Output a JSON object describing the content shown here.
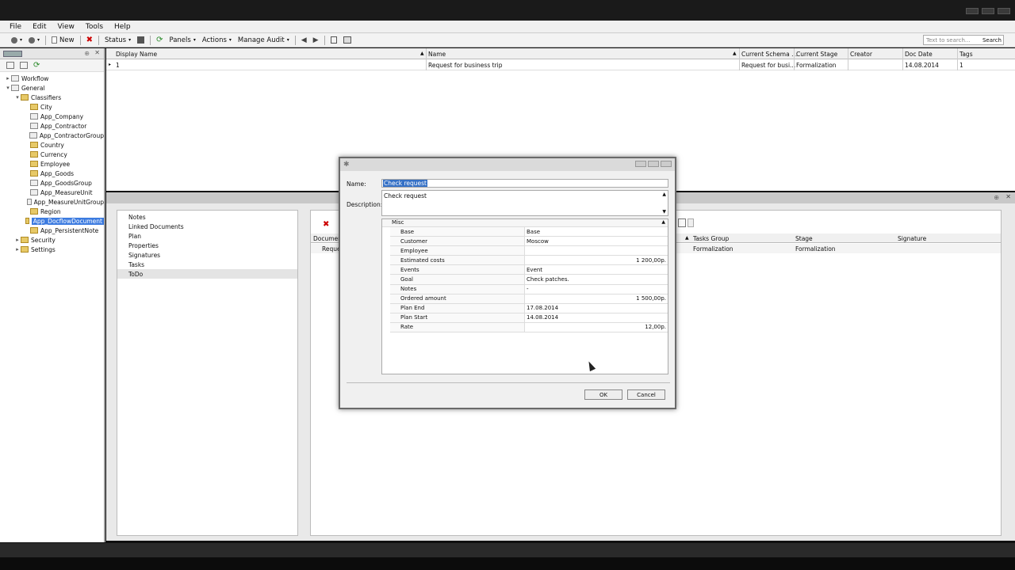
{
  "window": {
    "title": ""
  },
  "menu": [
    "File",
    "Edit",
    "View",
    "Tools",
    "Help"
  ],
  "toolbar": {
    "new": "New",
    "status": "Status",
    "panels": "Panels",
    "actions": "Actions",
    "manage_audit": "Manage Audit",
    "search_placeholder": "Text to search...",
    "search_button": "Search"
  },
  "tree": {
    "items": [
      {
        "label": "Workflow",
        "level": 0,
        "icon": "table-icon",
        "arrow": "▸"
      },
      {
        "label": "General",
        "level": 0,
        "icon": "table-icon",
        "arrow": "▾"
      },
      {
        "label": "Classifiers",
        "level": 1,
        "icon": "folder-icon",
        "arrow": "▾"
      },
      {
        "label": "City",
        "level": 2,
        "icon": "folder-icon"
      },
      {
        "label": "App_Company",
        "level": 2,
        "icon": "table-icon"
      },
      {
        "label": "App_Contractor",
        "level": 2,
        "icon": "table-icon"
      },
      {
        "label": "App_ContractorGroup",
        "level": 2,
        "icon": "table-icon"
      },
      {
        "label": "Country",
        "level": 2,
        "icon": "folder-icon"
      },
      {
        "label": "Currency",
        "level": 2,
        "icon": "folder-icon"
      },
      {
        "label": "Employee",
        "level": 2,
        "icon": "folder-icon"
      },
      {
        "label": "App_Goods",
        "level": 2,
        "icon": "folder-icon"
      },
      {
        "label": "App_GoodsGroup",
        "level": 2,
        "icon": "table-icon"
      },
      {
        "label": "App_MeasureUnit",
        "level": 2,
        "icon": "table-icon"
      },
      {
        "label": "App_MeasureUnitGroup",
        "level": 2,
        "icon": "table-icon"
      },
      {
        "label": "Region",
        "level": 2,
        "icon": "folder-icon"
      },
      {
        "label": "App_DocflowDocument",
        "level": 2,
        "icon": "folder-icon",
        "selected": true
      },
      {
        "label": "App_PersistentNote",
        "level": 2,
        "icon": "folder-icon"
      },
      {
        "label": "Security",
        "level": 1,
        "icon": "folder-icon",
        "arrow": "▸"
      },
      {
        "label": "Settings",
        "level": 1,
        "icon": "folder-icon",
        "arrow": "▸"
      }
    ]
  },
  "grid": {
    "columns": [
      "Display Name",
      "Name",
      "Current Schema ...",
      "Current Stage",
      "Creator",
      "Doc Date",
      "Tags"
    ],
    "row": [
      "1",
      "Request for business trip",
      "Request for busi...",
      "Formalization",
      "",
      "14.08.2014",
      "1"
    ]
  },
  "detail": {
    "sidelist": [
      "Notes",
      "Linked Documents",
      "Plan",
      "Properties",
      "Signatures",
      "Tasks",
      "ToDo"
    ],
    "columns": [
      "Document",
      "Tasks Group",
      "Stage",
      "Signature"
    ],
    "row": [
      "Reque",
      "Formalization",
      "Formalization",
      ""
    ]
  },
  "dialog": {
    "name_label": "Name:",
    "name_value": "Check request",
    "desc_label": "Description:",
    "desc_value": "Check request",
    "category": "Misc",
    "props": [
      {
        "name": "Base",
        "value": "Base"
      },
      {
        "name": "Customer",
        "value": "Moscow"
      },
      {
        "name": "Employee",
        "value": ""
      },
      {
        "name": "Estimated costs",
        "value": "1 200,00р.",
        "right": true
      },
      {
        "name": "Events",
        "value": "Event"
      },
      {
        "name": "Goal",
        "value": "Check patches."
      },
      {
        "name": "Notes",
        "value": "-"
      },
      {
        "name": "Ordered amount",
        "value": "1 500,00р.",
        "right": true
      },
      {
        "name": "Plan End",
        "value": "17.08.2014"
      },
      {
        "name": "Plan Start",
        "value": "14.08.2014"
      },
      {
        "name": "Rate",
        "value": "12,00р.",
        "right": true
      }
    ],
    "ok": "OK",
    "cancel": "Cancel"
  }
}
